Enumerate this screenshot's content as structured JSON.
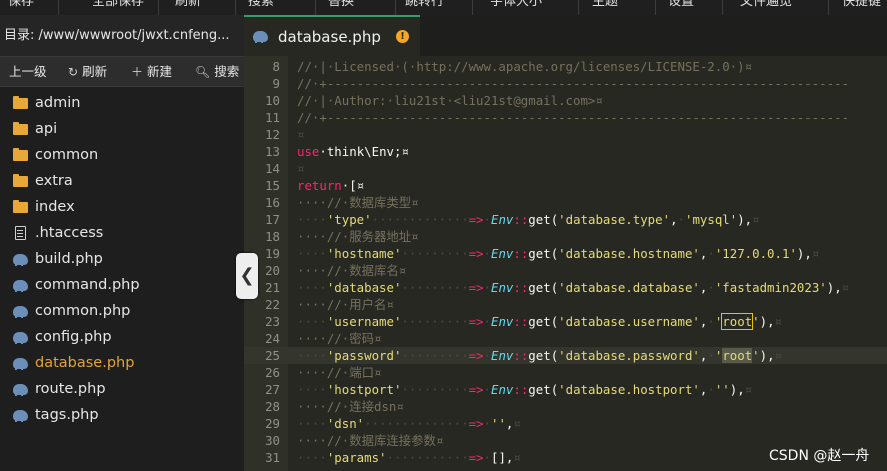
{
  "toolbar": {
    "items": [
      "保存",
      "全部保存",
      "刷新",
      "搜索",
      "替换",
      "跳转行",
      "字体大小",
      "主题",
      "设置",
      "文件遍览",
      "快捷键"
    ]
  },
  "sidebar": {
    "path_label": "目录: /www/wwwroot/jwxt.cnfeng...",
    "actions": {
      "up": "上一级",
      "refresh": "刷新",
      "new": "新建",
      "search": "搜索"
    },
    "items": [
      {
        "label": "admin",
        "type": "folder"
      },
      {
        "label": "api",
        "type": "folder"
      },
      {
        "label": "common",
        "type": "folder"
      },
      {
        "label": "extra",
        "type": "folder"
      },
      {
        "label": "index",
        "type": "folder"
      },
      {
        "label": ".htaccess",
        "type": "file"
      },
      {
        "label": "build.php",
        "type": "php"
      },
      {
        "label": "command.php",
        "type": "php"
      },
      {
        "label": "common.php",
        "type": "php"
      },
      {
        "label": "config.php",
        "type": "php"
      },
      {
        "label": "database.php",
        "type": "php",
        "active": true
      },
      {
        "label": "route.php",
        "type": "php"
      },
      {
        "label": "tags.php",
        "type": "php"
      }
    ]
  },
  "tab": {
    "label": "database.php",
    "modified_mark": "!"
  },
  "editor": {
    "line_numbers": [
      "8",
      "9",
      "10",
      "11",
      "12",
      "13",
      "14",
      "15",
      "16",
      "17",
      "18",
      "19",
      "20",
      "21",
      "22",
      "23",
      "24",
      "25",
      "26",
      "27",
      "28",
      "29",
      "30",
      "31"
    ],
    "lines": {
      "l8": "//·|·Licensed·(·http://www.apache.org/licenses/LICENSE-2.0·)¤",
      "l9": "//·+----------------------------------------------------------------------",
      "l10": "//·|·Author:·liu21st·<liu21st@gmail.com>¤",
      "l11": "//·+----------------------------------------------------------------------",
      "l12": "¤",
      "l13_kw": "use",
      "l13_rest": "·think\\Env;¤",
      "l14": "¤",
      "l15_kw": "return",
      "l15_rest": "·[¤",
      "l16": "····//·数据库类型¤",
      "l17_key": "'type'",
      "l17_val": "'mysql'",
      "l17_arg": "'database.type'",
      "l18": "····//·服务器地址¤",
      "l19_key": "'hostname'",
      "l19_arg": "'database.hostname'",
      "l19_val": "'127.0.0.1'",
      "l20": "····//·数据库名¤",
      "l21_key": "'database'",
      "l21_arg": "'database.database'",
      "l21_val": "'fastadmin2023'",
      "l22": "····//·用户名¤",
      "l23_key": "'username'",
      "l23_arg": "'database.username'",
      "l23_val": "root",
      "l24": "····//·密码¤",
      "l25_key": "'password'",
      "l25_arg": "'database.password'",
      "l25_val": "root",
      "l26": "····//·端口¤",
      "l27_key": "'hostport'",
      "l27_arg": "'database.hostport'",
      "l27_val": "''",
      "l28": "····//·连接dsn¤",
      "l29_key": "'dsn'",
      "l29_val": "''",
      "l30": "····//·数据库连接参数¤",
      "l31_key": "'params'",
      "l31_val": "[]"
    },
    "env_class": "Env",
    "get_fn": "get",
    "arrow": "=>"
  },
  "watermark": "CSDN @赵一舟",
  "colors": {
    "accent_active_file": "#e5a23a",
    "tab_modified": "#f5a623",
    "keyword": "#f92672",
    "string": "#e6db74",
    "class": "#66d9ef",
    "comment": "#75715e"
  }
}
